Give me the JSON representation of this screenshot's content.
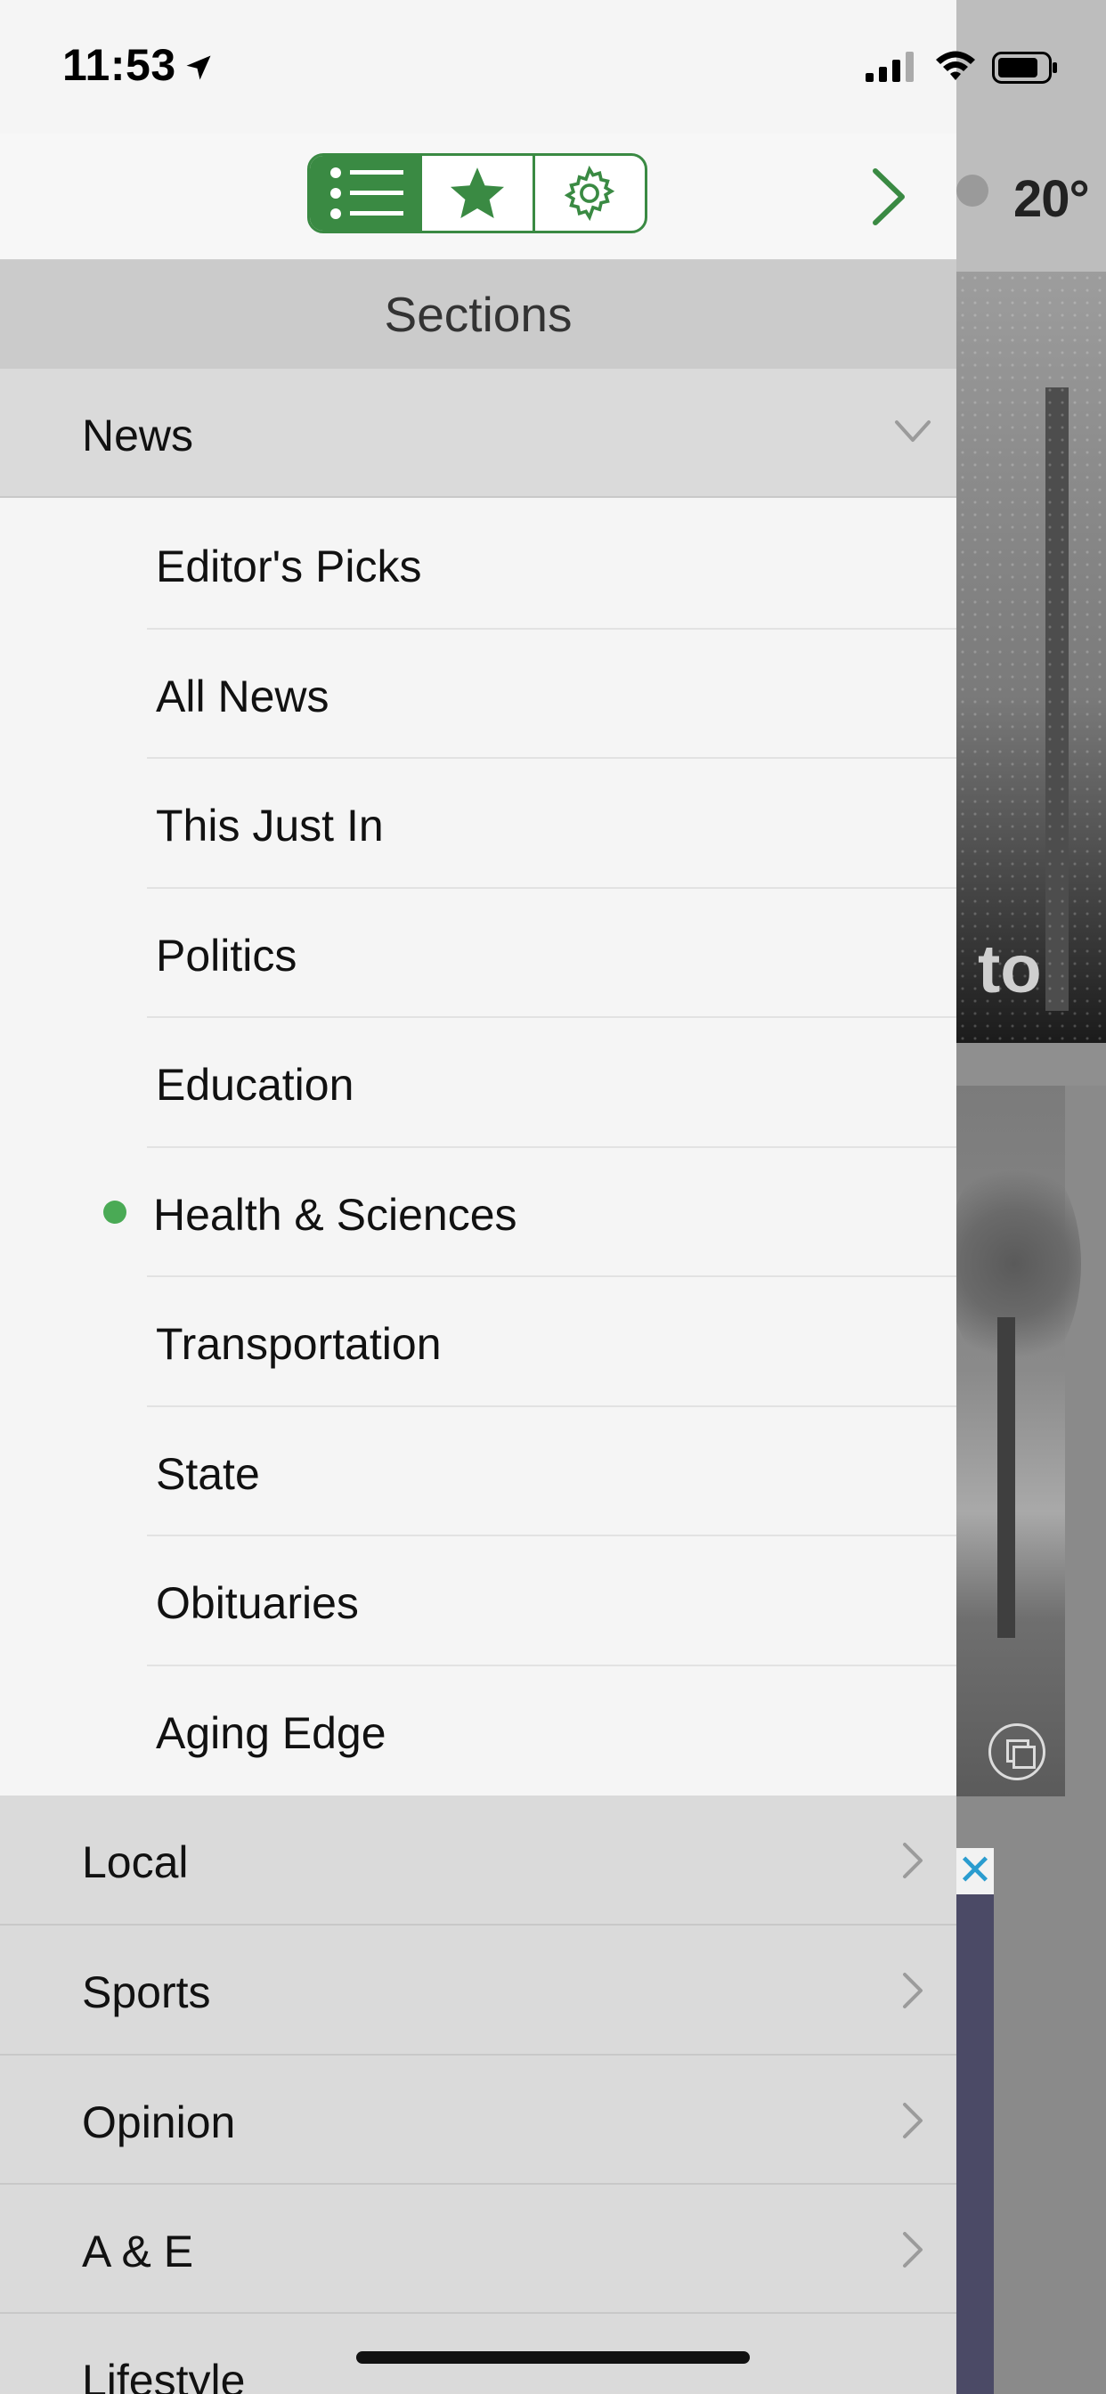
{
  "status_bar": {
    "time": "11:53"
  },
  "toolbar": {
    "segments": [
      {
        "name": "sections",
        "icon": "list-icon",
        "active": true
      },
      {
        "name": "favorites",
        "icon": "star-icon",
        "active": false
      },
      {
        "name": "settings",
        "icon": "gear-icon",
        "active": false
      }
    ],
    "accent_color": "#3a8a43"
  },
  "sections_header": "Sections",
  "news_group": {
    "label": "News",
    "expanded": true,
    "items": [
      {
        "label": "Editor's Picks",
        "selected": false
      },
      {
        "label": "All News",
        "selected": false
      },
      {
        "label": "This Just In",
        "selected": false
      },
      {
        "label": "Politics",
        "selected": false
      },
      {
        "label": "Education",
        "selected": false
      },
      {
        "label": "Health & Sciences",
        "selected": true
      },
      {
        "label": "Transportation",
        "selected": false
      },
      {
        "label": "State",
        "selected": false
      },
      {
        "label": "Obituaries",
        "selected": false
      },
      {
        "label": "Aging Edge",
        "selected": false
      }
    ]
  },
  "other_groups": [
    {
      "label": "Local"
    },
    {
      "label": "Sports"
    },
    {
      "label": "Opinion"
    },
    {
      "label": "A & E"
    },
    {
      "label": "Lifestyle"
    }
  ],
  "background": {
    "temperature": "20°",
    "headline_fragment": "to",
    "ad_close": "✕"
  },
  "selected_dot_color": "#4aaa55"
}
